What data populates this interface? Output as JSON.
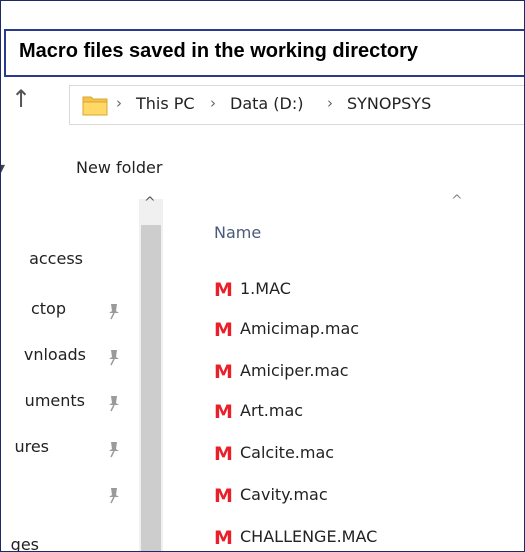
{
  "caption": "Macro files saved in the working directory",
  "address_bar": {
    "breadcrumbs": [
      "This PC",
      "Data (D:)",
      "SYNOPSYS"
    ]
  },
  "toolbar": {
    "new_folder_label": "New folder"
  },
  "nav_pane": {
    "items": [
      {
        "label": "access",
        "pinned": false
      },
      {
        "label": "ctop",
        "pinned": true
      },
      {
        "label": "vnloads",
        "pinned": true
      },
      {
        "label": "uments",
        "pinned": true
      },
      {
        "label": "ures",
        "pinned": true
      },
      {
        "label": "",
        "pinned": true
      },
      {
        "label": "ges",
        "pinned": false
      }
    ]
  },
  "file_list": {
    "column_name": "Name",
    "files": [
      "1.MAC",
      "Amicimap.mac",
      "Amiciper.mac",
      "Art.mac",
      "Calcite.mac",
      "Cavity.mac",
      "CHALLENGE.MAC"
    ]
  },
  "colors": {
    "macro_icon": "#e8202a",
    "caption_border": "#2a3b8f",
    "folder": "#f5c34a"
  },
  "icons": {
    "up": "up-arrow-icon",
    "folder": "folder-icon",
    "pin": "pin-icon",
    "macro": "macro-file-icon",
    "sort": "sort-ascending-icon"
  }
}
